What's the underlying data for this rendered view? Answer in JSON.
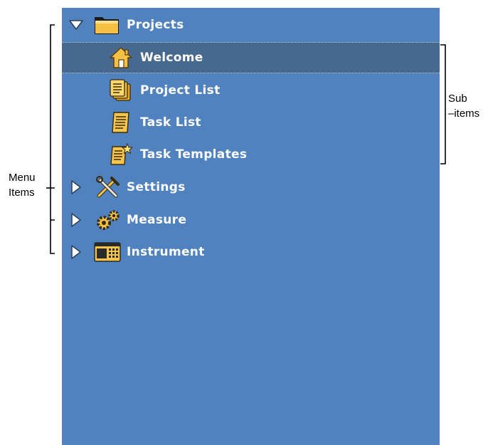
{
  "annotations": {
    "menu_items_line1": "Menu",
    "menu_items_line2": "Items",
    "sub_items_line1": "Sub",
    "sub_items_line2": "–items"
  },
  "menu": {
    "projects": {
      "label": "Projects",
      "icon": "folder-icon",
      "expanded": true,
      "children": [
        {
          "label": "Welcome",
          "icon": "home-icon",
          "selected": true
        },
        {
          "label": "Project List",
          "icon": "document-stack-icon"
        },
        {
          "label": "Task List",
          "icon": "document-icon"
        },
        {
          "label": "Task Templates",
          "icon": "document-star-icon"
        }
      ]
    },
    "settings": {
      "label": "Settings",
      "icon": "tools-icon",
      "expanded": false
    },
    "measure": {
      "label": "Measure",
      "icon": "gears-icon",
      "expanded": false
    },
    "instrument": {
      "label": "Instrument",
      "icon": "instrument-icon",
      "expanded": false
    }
  },
  "colors": {
    "panel_bg": "#4f82bf",
    "selected_bg": "#47698f",
    "text": "#ffffff",
    "icon_gold": "#f3c24b"
  }
}
